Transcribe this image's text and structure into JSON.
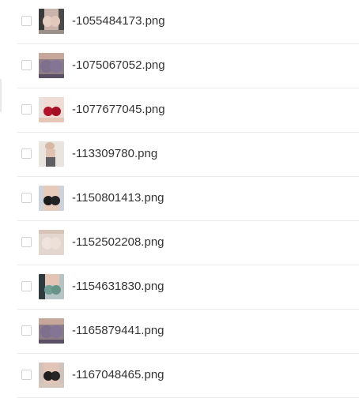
{
  "files": [
    {
      "name": "-1055484173.png",
      "thumbnail_icon": "image-thumbnail-icon"
    },
    {
      "name": "-1075067052.png",
      "thumbnail_icon": "image-thumbnail-icon"
    },
    {
      "name": "-1077677045.png",
      "thumbnail_icon": "image-thumbnail-icon"
    },
    {
      "name": "-113309780.png",
      "thumbnail_icon": "image-thumbnail-icon"
    },
    {
      "name": "-1150801413.png",
      "thumbnail_icon": "image-thumbnail-icon"
    },
    {
      "name": "-1152502208.png",
      "thumbnail_icon": "image-thumbnail-icon"
    },
    {
      "name": "-1154631830.png",
      "thumbnail_icon": "image-thumbnail-icon"
    },
    {
      "name": "-1165879441.png",
      "thumbnail_icon": "image-thumbnail-icon"
    },
    {
      "name": "-1167048465.png",
      "thumbnail_icon": "image-thumbnail-icon"
    }
  ],
  "colors": {
    "text": "#333333",
    "divider": "#ececec",
    "checkbox_border": "#d2d2d2",
    "background": "#ffffff"
  }
}
